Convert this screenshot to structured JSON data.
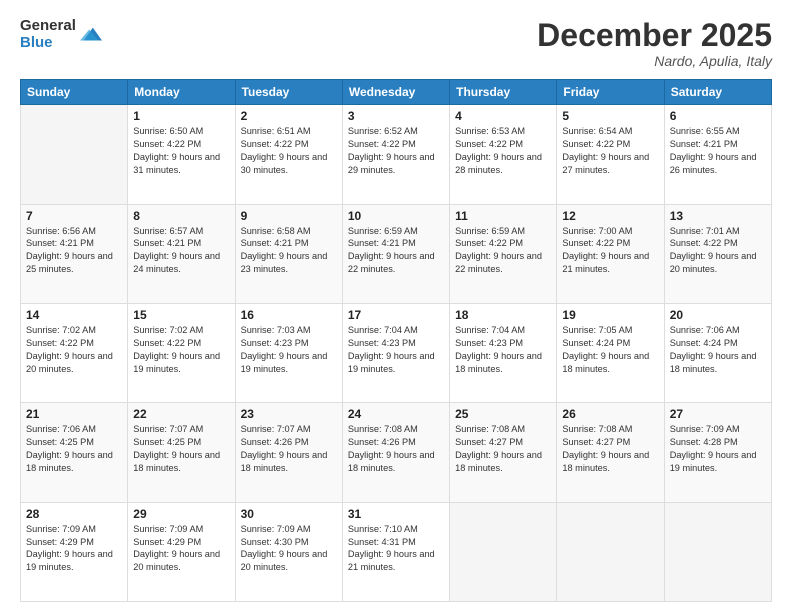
{
  "header": {
    "logo_general": "General",
    "logo_blue": "Blue",
    "month_title": "December 2025",
    "location": "Nardo, Apulia, Italy"
  },
  "days_of_week": [
    "Sunday",
    "Monday",
    "Tuesday",
    "Wednesday",
    "Thursday",
    "Friday",
    "Saturday"
  ],
  "weeks": [
    [
      {
        "day": "",
        "sunrise": "",
        "sunset": "",
        "daylight": ""
      },
      {
        "day": "1",
        "sunrise": "Sunrise: 6:50 AM",
        "sunset": "Sunset: 4:22 PM",
        "daylight": "Daylight: 9 hours and 31 minutes."
      },
      {
        "day": "2",
        "sunrise": "Sunrise: 6:51 AM",
        "sunset": "Sunset: 4:22 PM",
        "daylight": "Daylight: 9 hours and 30 minutes."
      },
      {
        "day": "3",
        "sunrise": "Sunrise: 6:52 AM",
        "sunset": "Sunset: 4:22 PM",
        "daylight": "Daylight: 9 hours and 29 minutes."
      },
      {
        "day": "4",
        "sunrise": "Sunrise: 6:53 AM",
        "sunset": "Sunset: 4:22 PM",
        "daylight": "Daylight: 9 hours and 28 minutes."
      },
      {
        "day": "5",
        "sunrise": "Sunrise: 6:54 AM",
        "sunset": "Sunset: 4:22 PM",
        "daylight": "Daylight: 9 hours and 27 minutes."
      },
      {
        "day": "6",
        "sunrise": "Sunrise: 6:55 AM",
        "sunset": "Sunset: 4:21 PM",
        "daylight": "Daylight: 9 hours and 26 minutes."
      }
    ],
    [
      {
        "day": "7",
        "sunrise": "Sunrise: 6:56 AM",
        "sunset": "Sunset: 4:21 PM",
        "daylight": "Daylight: 9 hours and 25 minutes."
      },
      {
        "day": "8",
        "sunrise": "Sunrise: 6:57 AM",
        "sunset": "Sunset: 4:21 PM",
        "daylight": "Daylight: 9 hours and 24 minutes."
      },
      {
        "day": "9",
        "sunrise": "Sunrise: 6:58 AM",
        "sunset": "Sunset: 4:21 PM",
        "daylight": "Daylight: 9 hours and 23 minutes."
      },
      {
        "day": "10",
        "sunrise": "Sunrise: 6:59 AM",
        "sunset": "Sunset: 4:21 PM",
        "daylight": "Daylight: 9 hours and 22 minutes."
      },
      {
        "day": "11",
        "sunrise": "Sunrise: 6:59 AM",
        "sunset": "Sunset: 4:22 PM",
        "daylight": "Daylight: 9 hours and 22 minutes."
      },
      {
        "day": "12",
        "sunrise": "Sunrise: 7:00 AM",
        "sunset": "Sunset: 4:22 PM",
        "daylight": "Daylight: 9 hours and 21 minutes."
      },
      {
        "day": "13",
        "sunrise": "Sunrise: 7:01 AM",
        "sunset": "Sunset: 4:22 PM",
        "daylight": "Daylight: 9 hours and 20 minutes."
      }
    ],
    [
      {
        "day": "14",
        "sunrise": "Sunrise: 7:02 AM",
        "sunset": "Sunset: 4:22 PM",
        "daylight": "Daylight: 9 hours and 20 minutes."
      },
      {
        "day": "15",
        "sunrise": "Sunrise: 7:02 AM",
        "sunset": "Sunset: 4:22 PM",
        "daylight": "Daylight: 9 hours and 19 minutes."
      },
      {
        "day": "16",
        "sunrise": "Sunrise: 7:03 AM",
        "sunset": "Sunset: 4:23 PM",
        "daylight": "Daylight: 9 hours and 19 minutes."
      },
      {
        "day": "17",
        "sunrise": "Sunrise: 7:04 AM",
        "sunset": "Sunset: 4:23 PM",
        "daylight": "Daylight: 9 hours and 19 minutes."
      },
      {
        "day": "18",
        "sunrise": "Sunrise: 7:04 AM",
        "sunset": "Sunset: 4:23 PM",
        "daylight": "Daylight: 9 hours and 18 minutes."
      },
      {
        "day": "19",
        "sunrise": "Sunrise: 7:05 AM",
        "sunset": "Sunset: 4:24 PM",
        "daylight": "Daylight: 9 hours and 18 minutes."
      },
      {
        "day": "20",
        "sunrise": "Sunrise: 7:06 AM",
        "sunset": "Sunset: 4:24 PM",
        "daylight": "Daylight: 9 hours and 18 minutes."
      }
    ],
    [
      {
        "day": "21",
        "sunrise": "Sunrise: 7:06 AM",
        "sunset": "Sunset: 4:25 PM",
        "daylight": "Daylight: 9 hours and 18 minutes."
      },
      {
        "day": "22",
        "sunrise": "Sunrise: 7:07 AM",
        "sunset": "Sunset: 4:25 PM",
        "daylight": "Daylight: 9 hours and 18 minutes."
      },
      {
        "day": "23",
        "sunrise": "Sunrise: 7:07 AM",
        "sunset": "Sunset: 4:26 PM",
        "daylight": "Daylight: 9 hours and 18 minutes."
      },
      {
        "day": "24",
        "sunrise": "Sunrise: 7:08 AM",
        "sunset": "Sunset: 4:26 PM",
        "daylight": "Daylight: 9 hours and 18 minutes."
      },
      {
        "day": "25",
        "sunrise": "Sunrise: 7:08 AM",
        "sunset": "Sunset: 4:27 PM",
        "daylight": "Daylight: 9 hours and 18 minutes."
      },
      {
        "day": "26",
        "sunrise": "Sunrise: 7:08 AM",
        "sunset": "Sunset: 4:27 PM",
        "daylight": "Daylight: 9 hours and 18 minutes."
      },
      {
        "day": "27",
        "sunrise": "Sunrise: 7:09 AM",
        "sunset": "Sunset: 4:28 PM",
        "daylight": "Daylight: 9 hours and 19 minutes."
      }
    ],
    [
      {
        "day": "28",
        "sunrise": "Sunrise: 7:09 AM",
        "sunset": "Sunset: 4:29 PM",
        "daylight": "Daylight: 9 hours and 19 minutes."
      },
      {
        "day": "29",
        "sunrise": "Sunrise: 7:09 AM",
        "sunset": "Sunset: 4:29 PM",
        "daylight": "Daylight: 9 hours and 20 minutes."
      },
      {
        "day": "30",
        "sunrise": "Sunrise: 7:09 AM",
        "sunset": "Sunset: 4:30 PM",
        "daylight": "Daylight: 9 hours and 20 minutes."
      },
      {
        "day": "31",
        "sunrise": "Sunrise: 7:10 AM",
        "sunset": "Sunset: 4:31 PM",
        "daylight": "Daylight: 9 hours and 21 minutes."
      },
      {
        "day": "",
        "sunrise": "",
        "sunset": "",
        "daylight": ""
      },
      {
        "day": "",
        "sunrise": "",
        "sunset": "",
        "daylight": ""
      },
      {
        "day": "",
        "sunrise": "",
        "sunset": "",
        "daylight": ""
      }
    ]
  ]
}
